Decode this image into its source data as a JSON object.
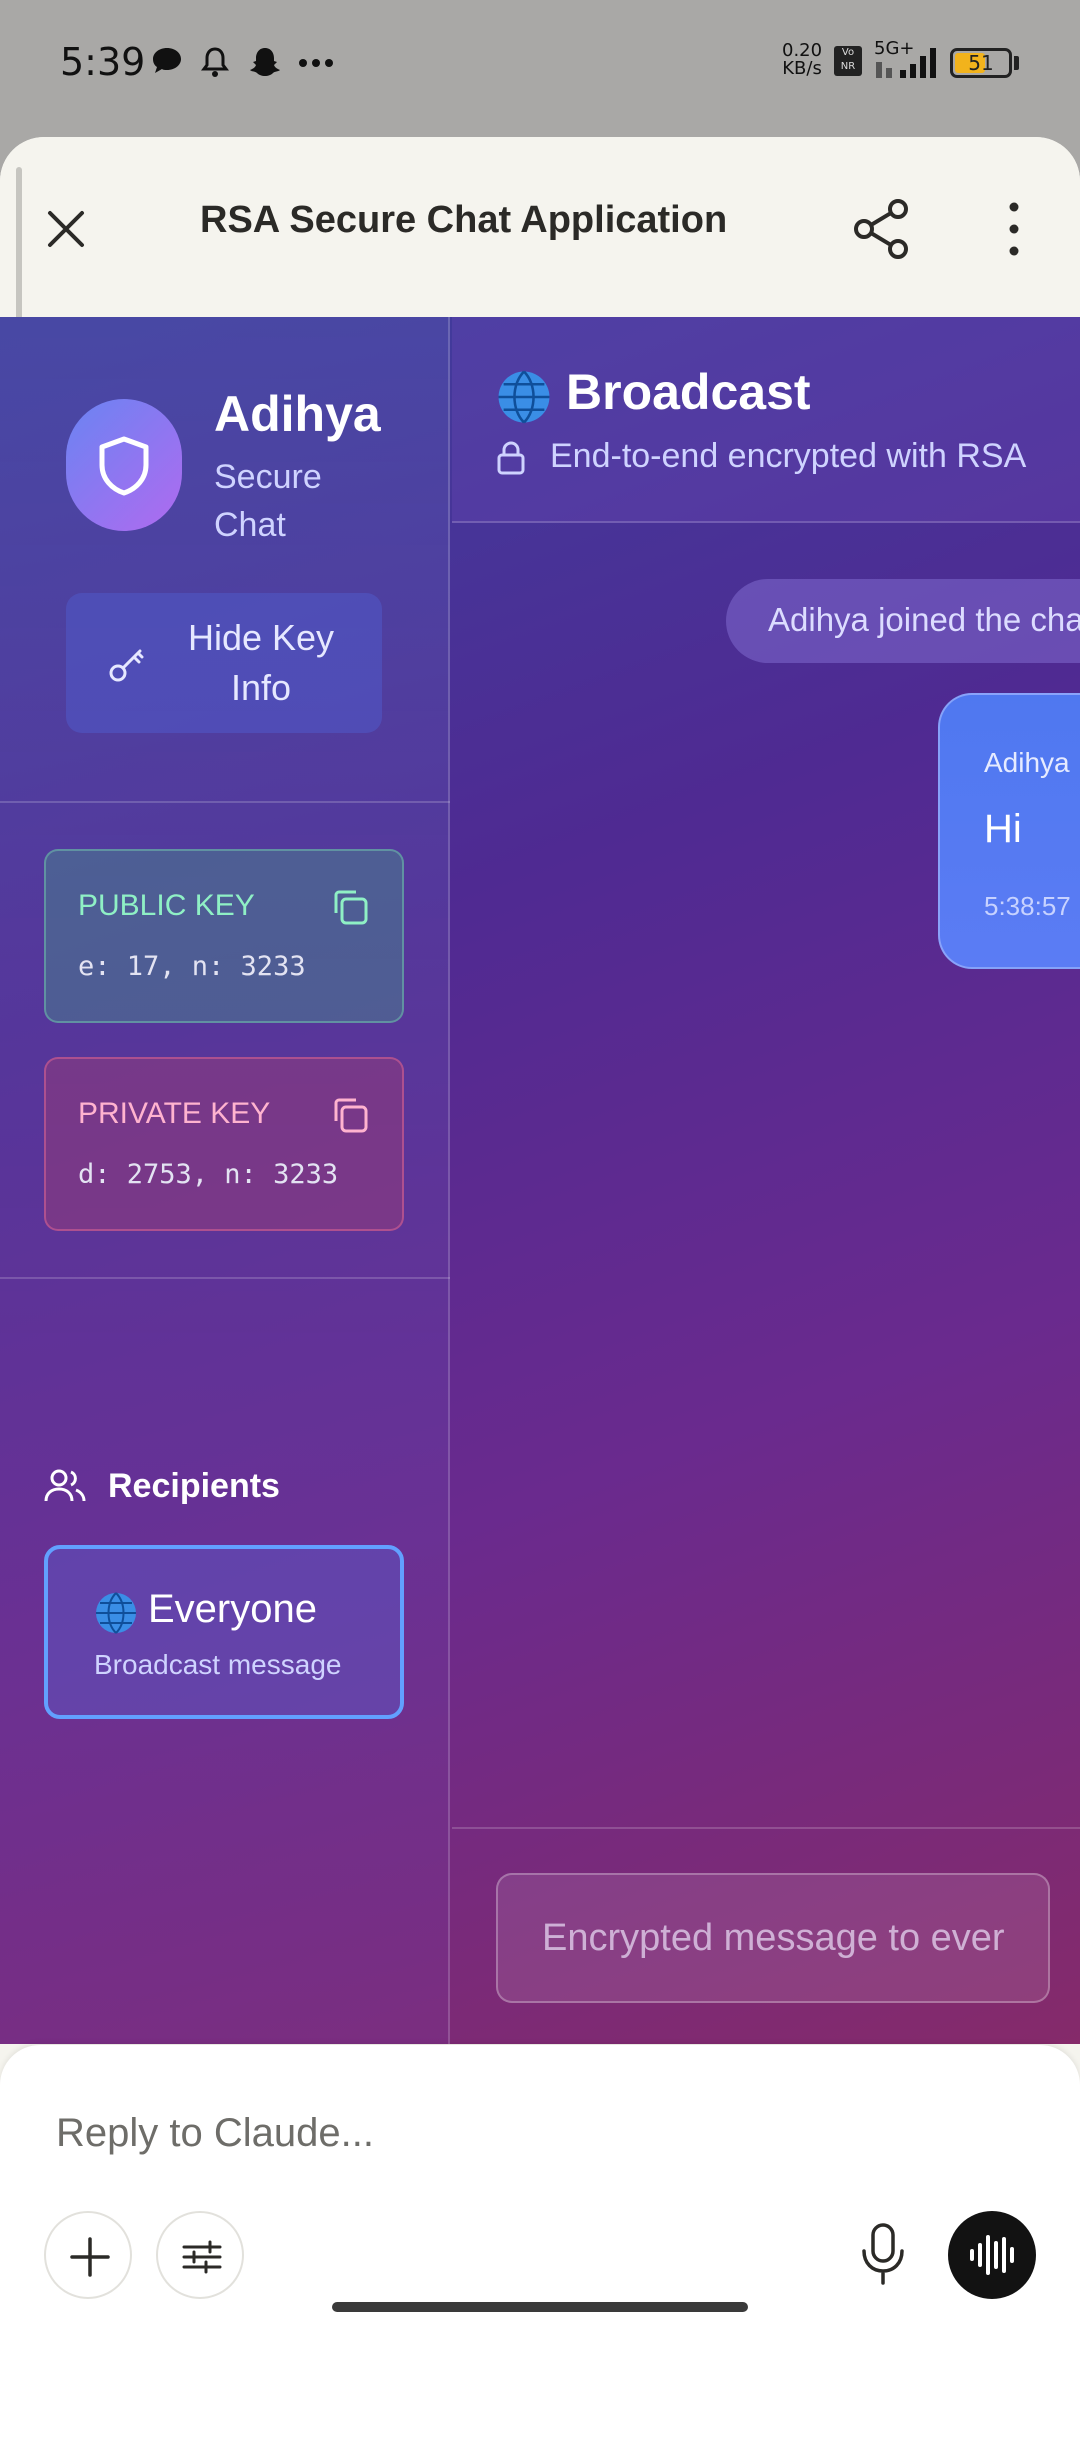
{
  "status_bar": {
    "time": "5:39",
    "net_speed_value": "0.20",
    "net_speed_unit": "KB/s",
    "vonr": "Vo NR",
    "signal": "5G+",
    "battery": "51"
  },
  "header": {
    "title": "RSA Secure Chat Application"
  },
  "sidebar": {
    "brand_name": "Adihya",
    "brand_sub": "Secure Chat",
    "hide_key_label": "Hide Key Info",
    "public_key": {
      "title": "PUBLIC KEY",
      "value": "e: 17, n: 3233"
    },
    "private_key": {
      "title": "PRIVATE KEY",
      "value": "d: 2753, n: 3233"
    },
    "recipients_label": "Recipients",
    "recipient": {
      "name": "Everyone",
      "sub": "Broadcast message"
    }
  },
  "chat": {
    "title": "Broadcast",
    "encryption_note": "End-to-end encrypted with RSA",
    "system_message": "Adihya joined the chat",
    "messages": [
      {
        "sender": "Adihya",
        "text": "Hi",
        "time": "5:38:57"
      }
    ],
    "input_placeholder": "Encrypted message to everyone"
  },
  "reply": {
    "placeholder": "Reply to Claude..."
  },
  "colors": {
    "accent_blue": "#62a0ff",
    "bubble_blue": "#5b7cf4",
    "public_green": "#8ff0c5",
    "private_pink": "#ffb3cf"
  }
}
